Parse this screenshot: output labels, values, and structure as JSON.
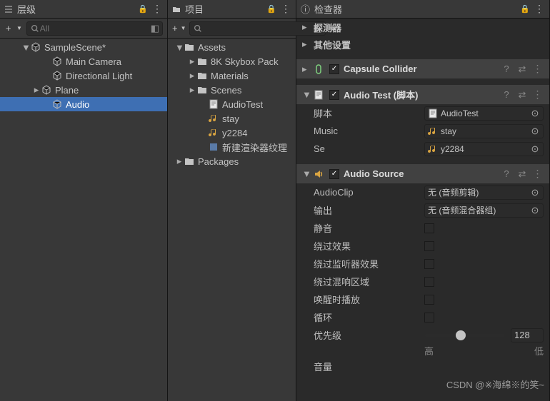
{
  "hierarchy": {
    "title": "层级",
    "search_placeholder": "All",
    "items": [
      {
        "label": "SampleScene*",
        "indent": 30,
        "chev": "▼",
        "icon": "cube"
      },
      {
        "label": "Main Camera",
        "indent": 60,
        "chev": "",
        "icon": "cube"
      },
      {
        "label": "Directional Light",
        "indent": 60,
        "chev": "",
        "icon": "cube"
      },
      {
        "label": "Plane",
        "indent": 45,
        "chev": "▸",
        "icon": "cube"
      },
      {
        "label": "Audio",
        "indent": 60,
        "chev": "",
        "icon": "cube",
        "selected": true
      }
    ]
  },
  "project": {
    "title": "项目",
    "search_placeholder": "",
    "items": [
      {
        "label": "Assets",
        "indent": 10,
        "chev": "▼",
        "icon": "folder"
      },
      {
        "label": "8K Skybox Pack",
        "indent": 28,
        "chev": "▸",
        "icon": "folder"
      },
      {
        "label": "Materials",
        "indent": 28,
        "chev": "▸",
        "icon": "folder"
      },
      {
        "label": "Scenes",
        "indent": 28,
        "chev": "▸",
        "icon": "folder"
      },
      {
        "label": "AudioTest",
        "indent": 44,
        "chev": "",
        "icon": "script"
      },
      {
        "label": "stay",
        "indent": 44,
        "chev": "",
        "icon": "audio"
      },
      {
        "label": "y2284",
        "indent": 44,
        "chev": "",
        "icon": "audio"
      },
      {
        "label": "新建渲染器纹理",
        "indent": 44,
        "chev": "",
        "icon": "asset"
      },
      {
        "label": "Packages",
        "indent": 10,
        "chev": "▸",
        "icon": "folder"
      }
    ]
  },
  "inspector": {
    "title": "检查器",
    "sections": [
      {
        "label": "探测器"
      },
      {
        "label": "其他设置"
      }
    ],
    "components": [
      {
        "name": "Capsule Collider",
        "icon": "collider",
        "checked": true,
        "folded": true
      },
      {
        "name": "Audio Test   (脚本)",
        "icon": "script",
        "checked": true,
        "folded": false,
        "props": [
          {
            "label": "脚本",
            "type": "obj",
            "value": "AudioTest",
            "obj_icon": "script"
          },
          {
            "label": "Music",
            "type": "obj",
            "value": "stay",
            "obj_icon": "audio"
          },
          {
            "label": "Se",
            "type": "obj",
            "value": "y2284",
            "obj_icon": "audio"
          }
        ]
      },
      {
        "name": "Audio Source",
        "icon": "audiosrc",
        "checked": true,
        "folded": false,
        "props": [
          {
            "label": "AudioClip",
            "type": "obj",
            "value": "无 (音频剪辑)"
          },
          {
            "label": "输出",
            "type": "obj",
            "value": "无 (音频混合器组)"
          },
          {
            "label": "静音",
            "type": "check",
            "value": false
          },
          {
            "label": "绕过效果",
            "type": "check",
            "value": false
          },
          {
            "label": "绕过监听器效果",
            "type": "check",
            "value": false
          },
          {
            "label": "绕过混响区域",
            "type": "check",
            "value": false
          },
          {
            "label": "唤醒时播放",
            "type": "check",
            "value": false
          },
          {
            "label": "循环",
            "type": "check",
            "value": false
          },
          {
            "label": "优先级",
            "type": "slider",
            "value": 128,
            "percent": 45,
            "low": "高",
            "high": "低"
          },
          {
            "label": "音量",
            "type": "label_only"
          }
        ]
      }
    ]
  },
  "watermark": "CSDN @※海绵※的笑~"
}
